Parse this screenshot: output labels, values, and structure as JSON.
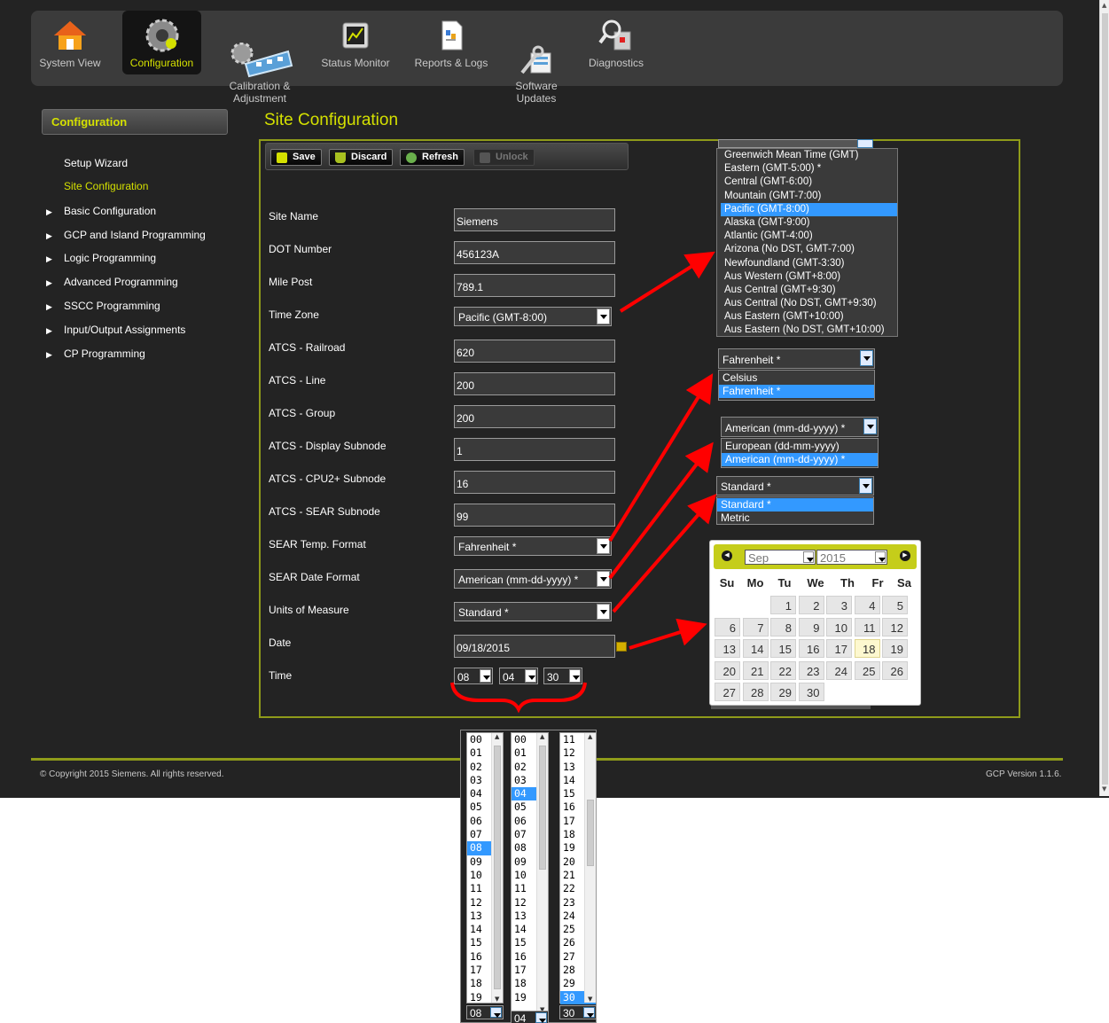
{
  "nav": {
    "items": [
      {
        "label": "System View",
        "icon": "house-icon"
      },
      {
        "label": "Configuration",
        "icon": "gears-icon"
      },
      {
        "label": "Calibration &\nAdjustment",
        "icon": "gear-train-icon"
      },
      {
        "label": "Status Monitor",
        "icon": "monitor-icon"
      },
      {
        "label": "Reports & Logs",
        "icon": "report-icon"
      },
      {
        "label": "Software\nUpdates",
        "icon": "tools-update-icon"
      },
      {
        "label": "Diagnostics",
        "icon": "magnifier-icon"
      }
    ],
    "active_index": 1
  },
  "sidebar": {
    "header": "Configuration",
    "items": [
      {
        "label": "Setup Wizard",
        "has_arrow": false
      },
      {
        "label": "Site Configuration",
        "has_arrow": false
      },
      {
        "label": "Basic Configuration",
        "has_arrow": true
      },
      {
        "label": "GCP and Island Programming",
        "has_arrow": true
      },
      {
        "label": "Logic Programming",
        "has_arrow": true
      },
      {
        "label": "Advanced Programming",
        "has_arrow": true
      },
      {
        "label": "SSCC Programming",
        "has_arrow": true
      },
      {
        "label": "Input/Output Assignments",
        "has_arrow": true
      },
      {
        "label": "CP Programming",
        "has_arrow": true
      }
    ]
  },
  "page": {
    "title": "Site Configuration"
  },
  "toolbar": {
    "save": "Save",
    "discard": "Discard",
    "refresh": "Refresh",
    "unlock": "Unlock"
  },
  "form": {
    "site_name": {
      "label": "Site Name",
      "value": "Siemens"
    },
    "dot_number": {
      "label": "DOT Number",
      "value": "456123A"
    },
    "mile_post": {
      "label": "Mile Post",
      "value": "789.1"
    },
    "time_zone": {
      "label": "Time Zone",
      "value": "Pacific (GMT-8:00)"
    },
    "atcs_railroad": {
      "label": "ATCS - Railroad",
      "value": "620"
    },
    "atcs_line": {
      "label": "ATCS - Line",
      "value": "200"
    },
    "atcs_group": {
      "label": "ATCS - Group",
      "value": "200"
    },
    "atcs_display_subnode": {
      "label": "ATCS - Display Subnode",
      "value": "1"
    },
    "atcs_cpu2_subnode": {
      "label": "ATCS - CPU2+ Subnode",
      "value": "16"
    },
    "atcs_sear_subnode": {
      "label": "ATCS - SEAR Subnode",
      "value": "99"
    },
    "sear_temp_format": {
      "label": "SEAR Temp. Format",
      "value": "Fahrenheit *"
    },
    "sear_date_format": {
      "label": "SEAR Date Format",
      "value": "American (mm-dd-yyyy) *"
    },
    "units_of_measure": {
      "label": "Units of Measure",
      "value": "Standard *"
    },
    "date": {
      "label": "Date",
      "value": "09/18/2015"
    },
    "time": {
      "label": "Time",
      "hour": "08",
      "minute": "04",
      "second": "30"
    }
  },
  "timezone_options": [
    "Greenwich Mean Time (GMT)",
    "Eastern (GMT-5:00) *",
    "Central (GMT-6:00)",
    "Mountain (GMT-7:00)",
    "Pacific (GMT-8:00)",
    "Alaska (GMT-9:00)",
    "Atlantic (GMT-4:00)",
    "Arizona (No DST, GMT-7:00)",
    "Newfoundland (GMT-3:30)",
    "Aus Western (GMT+8:00)",
    "Aus Central (GMT+9:30)",
    "Aus Central (No DST, GMT+9:30)",
    "Aus Eastern (GMT+10:00)",
    "Aus Eastern (No DST, GMT+10:00)"
  ],
  "timezone_selected_index": 4,
  "temp_dropdown": {
    "value": "Fahrenheit *",
    "options": [
      "Celsius",
      "Fahrenheit *"
    ],
    "selected_index": 1
  },
  "date_format_dropdown": {
    "value": "American (mm-dd-yyyy) *",
    "options": [
      "European (dd-mm-yyyy)",
      "American (mm-dd-yyyy) *"
    ],
    "selected_index": 1
  },
  "units_dropdown": {
    "value": "Standard *",
    "options": [
      "Standard *",
      "Metric"
    ],
    "selected_index": 0
  },
  "calendar": {
    "month": "Sep",
    "year": "2015",
    "weekdays": [
      "Su",
      "Mo",
      "Tu",
      "We",
      "Th",
      "Fr",
      "Sa"
    ],
    "first_weekday": 2,
    "days_in_month": 30,
    "today": 18
  },
  "time_picker": {
    "hours": [
      "00",
      "01",
      "02",
      "03",
      "04",
      "05",
      "06",
      "07",
      "08",
      "09",
      "10",
      "11",
      "12",
      "13",
      "14",
      "15",
      "16",
      "17",
      "18",
      "19"
    ],
    "minutes": [
      "00",
      "01",
      "02",
      "03",
      "04",
      "05",
      "06",
      "07",
      "08",
      "09",
      "10",
      "11",
      "12",
      "13",
      "14",
      "15",
      "16",
      "17",
      "18",
      "19"
    ],
    "seconds": [
      "11",
      "12",
      "13",
      "14",
      "15",
      "16",
      "17",
      "18",
      "19",
      "20",
      "21",
      "22",
      "23",
      "24",
      "25",
      "26",
      "27",
      "28",
      "29",
      "30"
    ],
    "hour_selected": "08",
    "minute_selected": "04",
    "second_selected": "30"
  },
  "footer": {
    "copyright": "© Copyright 2015 Siemens. All rights reserved.",
    "version": "GCP Version 1.1.6."
  },
  "colors": {
    "accent": "#d4e000",
    "panel_border": "#8f9b1a",
    "highlight": "#3399ff",
    "arrow": "#ff0000",
    "background": "#232323"
  }
}
